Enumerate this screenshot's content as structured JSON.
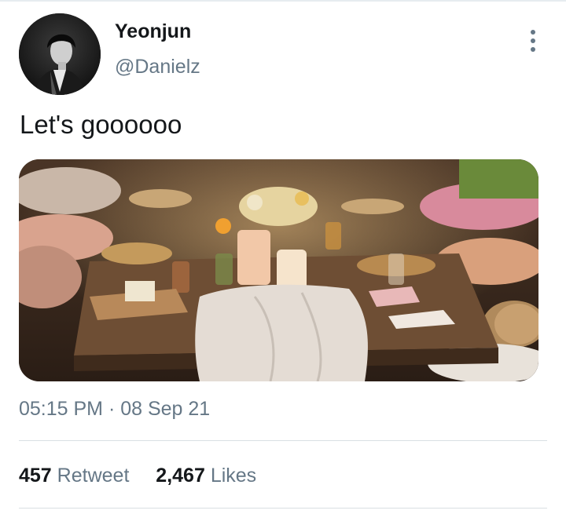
{
  "user": {
    "display_name": "Yeonjun",
    "handle": "@Danielz"
  },
  "tweet": {
    "text": "Let's goooooo",
    "timestamp": "05:15 PM · 08 Sep 21"
  },
  "stats": {
    "retweets_count": "457",
    "retweets_label": "Retweet",
    "likes_count": "2,467",
    "likes_label": "Likes"
  },
  "icons": {
    "more": "more-vertical-icon"
  },
  "colors": {
    "primary_text": "#14171a",
    "secondary_text": "#657786",
    "divider": "#d9dfe3"
  }
}
